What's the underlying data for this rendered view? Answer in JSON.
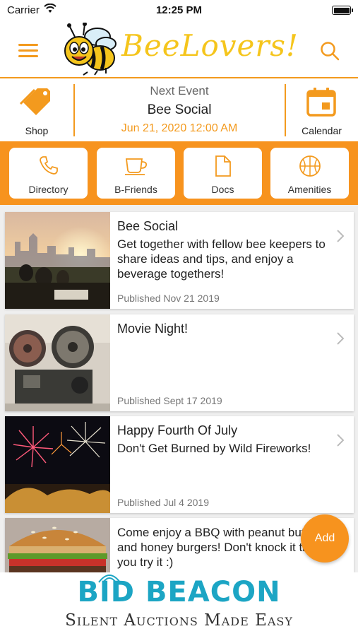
{
  "status_bar": {
    "carrier": "Carrier",
    "time": "12:25 PM"
  },
  "header": {
    "app_name": "BeeLovers!"
  },
  "event_bar": {
    "shop_label": "Shop",
    "heading": "Next Event",
    "event_name": "Bee Social",
    "event_datetime": "Jun 21, 2020 12:00 AM",
    "calendar_label": "Calendar"
  },
  "quick_tabs": [
    {
      "label": "Directory",
      "icon": "phone-icon"
    },
    {
      "label": "B-Friends",
      "icon": "coffee-cup-icon"
    },
    {
      "label": "Docs",
      "icon": "document-icon"
    },
    {
      "label": "Amenities",
      "icon": "basketball-icon"
    }
  ],
  "posts": [
    {
      "title": "Bee Social",
      "description": "Get together with fellow bee keepers to share ideas and tips, and enjoy a beverage togethers!",
      "published": "Published Nov 21 2019",
      "image": "city-sunset-picnic"
    },
    {
      "title": "Movie Night!",
      "description": "",
      "published": "Published Sept 17 2019",
      "image": "film-projector"
    },
    {
      "title": "Happy Fourth Of July",
      "description": "Don't Get Burned by Wild Fireworks!",
      "published": "Published Jul 4 2019",
      "image": "fireworks"
    },
    {
      "title": "",
      "description": "Come enjoy a BBQ with peanut butter and honey burgers! Don't knock it till you try it :)",
      "published": "",
      "image": "burger"
    }
  ],
  "add_button": {
    "label": "Add"
  },
  "banner": {
    "brand": "BID BEACON",
    "tagline": "Silent Auctions Made Easy"
  },
  "colors": {
    "accent": "#f7931e",
    "logo_yellow": "#f5c51c",
    "banner_blue": "#1ca5c4"
  }
}
